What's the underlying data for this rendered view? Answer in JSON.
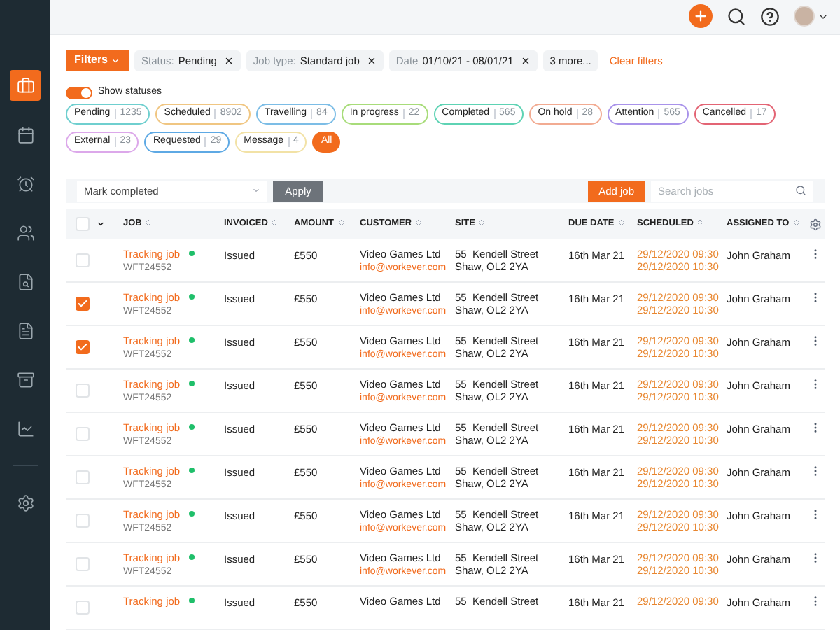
{
  "sidebar": {
    "items": [
      {
        "selected": true
      },
      {
        "selected": false
      },
      {
        "selected": false
      },
      {
        "selected": false
      },
      {
        "selected": false
      },
      {
        "selected": false
      },
      {
        "selected": false
      },
      {
        "selected": false
      },
      {
        "selected": false
      }
    ]
  },
  "filters": {
    "button": "Filters",
    "chips": [
      {
        "label": "Status:",
        "value": "Pending"
      },
      {
        "label": "Job type:",
        "value": "Standard job"
      },
      {
        "label": "Date",
        "value": "01/10/21 - 08/01/21"
      }
    ],
    "more": "3 more...",
    "clear": "Clear filters"
  },
  "show_statuses": {
    "label": "Show statuses",
    "on": true
  },
  "statuses": [
    {
      "name": "Pending",
      "count": "1235",
      "color": "#6fcfcf",
      "selected": false
    },
    {
      "name": "Scheduled",
      "count": "8902",
      "color": "#f0c682",
      "selected": false
    },
    {
      "name": "Travelling",
      "count": "84",
      "color": "#7cbde6",
      "selected": false
    },
    {
      "name": "In progress",
      "count": "22",
      "color": "#a8dc7a",
      "selected": false
    },
    {
      "name": "Completed",
      "count": "565",
      "color": "#5ed3b4",
      "selected": false
    },
    {
      "name": "On hold",
      "count": "28",
      "color": "#f2ab92",
      "selected": false
    },
    {
      "name": "Attention",
      "count": "565",
      "color": "#a993ea",
      "selected": false
    },
    {
      "name": "Cancelled",
      "count": "17",
      "color": "#e36474",
      "selected": false
    },
    {
      "name": "External",
      "count": "23",
      "color": "#dca8ea",
      "selected": false
    },
    {
      "name": "Requested",
      "count": "29",
      "color": "#5ea9e4",
      "selected": false
    },
    {
      "name": "Message",
      "count": "4",
      "color": "#f2e2a6",
      "selected": false
    },
    {
      "name": "All",
      "selected": true
    }
  ],
  "toolbar": {
    "bulk_action": "Mark completed",
    "apply": "Apply",
    "add_job": "Add job",
    "search_placeholder": "Search jobs"
  },
  "table": {
    "select_all": {
      "checked": false
    },
    "columns": [
      "JOB",
      "INVOICED",
      "AMOUNT",
      "CUSTOMER",
      "SITE",
      "DUE DATE",
      "SCHEDULED",
      "ASSIGNED TO"
    ],
    "rows": [
      {
        "checked": false,
        "job": "Tracking job",
        "ref": "WFT24552",
        "invoiced": "Issued",
        "amount": "£550",
        "customer": "Video Games Ltd",
        "email": "info@workever.com",
        "site": [
          "55  Kendell Street",
          "Shaw, OL2 2YA"
        ],
        "due": "16th Mar 21",
        "scheduled": [
          "29/12/2020 09:30",
          "29/12/2020 10:30"
        ],
        "assigned": "John Graham"
      },
      {
        "checked": true,
        "job": "Tracking job",
        "ref": "WFT24552",
        "invoiced": "Issued",
        "amount": "£550",
        "customer": "Video Games Ltd",
        "email": "info@workever.com",
        "site": [
          "55  Kendell Street",
          "Shaw, OL2 2YA"
        ],
        "due": "16th Mar 21",
        "scheduled": [
          "29/12/2020 09:30",
          "29/12/2020 10:30"
        ],
        "assigned": "John Graham"
      },
      {
        "checked": true,
        "job": "Tracking job",
        "ref": "WFT24552",
        "invoiced": "Issued",
        "amount": "£550",
        "customer": "Video Games Ltd",
        "email": "info@workever.com",
        "site": [
          "55  Kendell Street",
          "Shaw, OL2 2YA"
        ],
        "due": "16th Mar 21",
        "scheduled": [
          "29/12/2020 09:30",
          "29/12/2020 10:30"
        ],
        "assigned": "John Graham"
      },
      {
        "checked": false,
        "job": "Tracking job",
        "ref": "WFT24552",
        "invoiced": "Issued",
        "amount": "£550",
        "customer": "Video Games Ltd",
        "email": "info@workever.com",
        "site": [
          "55  Kendell Street",
          "Shaw, OL2 2YA"
        ],
        "due": "16th Mar 21",
        "scheduled": [
          "29/12/2020 09:30",
          "29/12/2020 10:30"
        ],
        "assigned": "John Graham"
      },
      {
        "checked": false,
        "job": "Tracking job",
        "ref": "WFT24552",
        "invoiced": "Issued",
        "amount": "£550",
        "customer": "Video Games Ltd",
        "email": "info@workever.com",
        "site": [
          "55  Kendell Street",
          "Shaw, OL2 2YA"
        ],
        "due": "16th Mar 21",
        "scheduled": [
          "29/12/2020 09:30",
          "29/12/2020 10:30"
        ],
        "assigned": "John Graham"
      },
      {
        "checked": false,
        "job": "Tracking job",
        "ref": "WFT24552",
        "invoiced": "Issued",
        "amount": "£550",
        "customer": "Video Games Ltd",
        "email": "info@workever.com",
        "site": [
          "55  Kendell Street",
          "Shaw, OL2 2YA"
        ],
        "due": "16th Mar 21",
        "scheduled": [
          "29/12/2020 09:30",
          "29/12/2020 10:30"
        ],
        "assigned": "John Graham"
      },
      {
        "checked": false,
        "job": "Tracking job",
        "ref": "WFT24552",
        "invoiced": "Issued",
        "amount": "£550",
        "customer": "Video Games Ltd",
        "email": "info@workever.com",
        "site": [
          "55  Kendell Street",
          "Shaw, OL2 2YA"
        ],
        "due": "16th Mar 21",
        "scheduled": [
          "29/12/2020 09:30",
          "29/12/2020 10:30"
        ],
        "assigned": "John Graham"
      },
      {
        "checked": false,
        "job": "Tracking job",
        "ref": "WFT24552",
        "invoiced": "Issued",
        "amount": "£550",
        "customer": "Video Games Ltd",
        "email": "info@workever.com",
        "site": [
          "55  Kendell Street",
          "Shaw, OL2 2YA"
        ],
        "due": "16th Mar 21",
        "scheduled": [
          "29/12/2020 09:30",
          "29/12/2020 10:30"
        ],
        "assigned": "John Graham"
      },
      {
        "checked": false,
        "job": "Tracking job",
        "invoiced": "Issued",
        "amount": "£550",
        "customer": "Video Games Ltd",
        "site": [
          "55  Kendell Street"
        ],
        "due": "16th Mar 21",
        "scheduled": [
          "29/12/2020 09:30"
        ],
        "assigned": "John Graham"
      }
    ]
  }
}
